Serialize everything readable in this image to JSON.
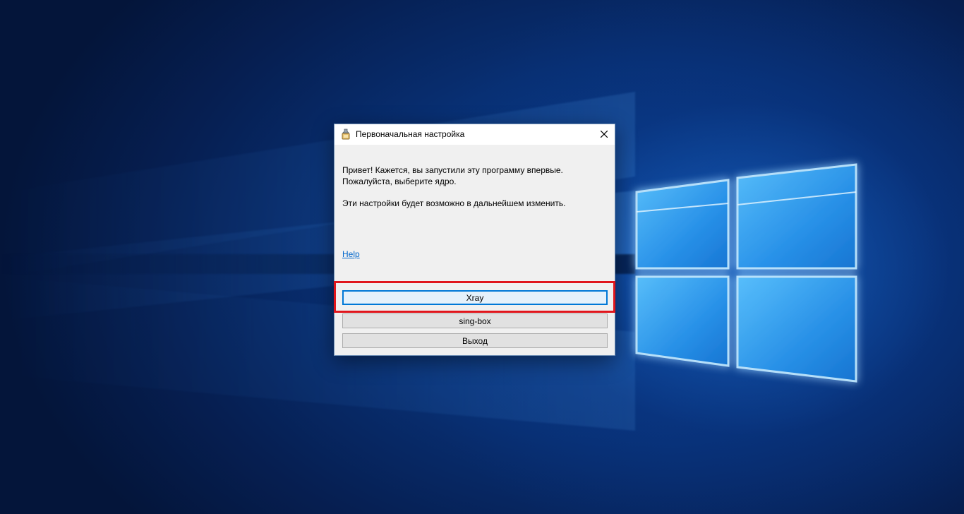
{
  "dialog": {
    "title": "Первоначальная настройка",
    "title_icon": "app-wrench-icon",
    "close_icon": "close-icon",
    "message": {
      "line1": "Привет! Кажется, вы запустили  эту программу впервые.",
      "line2": "Пожалуйста, выберите ядро.",
      "line3": "Эти настройки будет возможно в дальнейшем изменить."
    },
    "help_link": "Help",
    "buttons": {
      "xray": "Xray",
      "singbox": "sing-box",
      "exit": "Выход"
    }
  },
  "colors": {
    "highlight_border": "#e0161c",
    "focus_border": "#0078d7",
    "link": "#0066cc",
    "wallpaper": "#0b3f8e"
  }
}
